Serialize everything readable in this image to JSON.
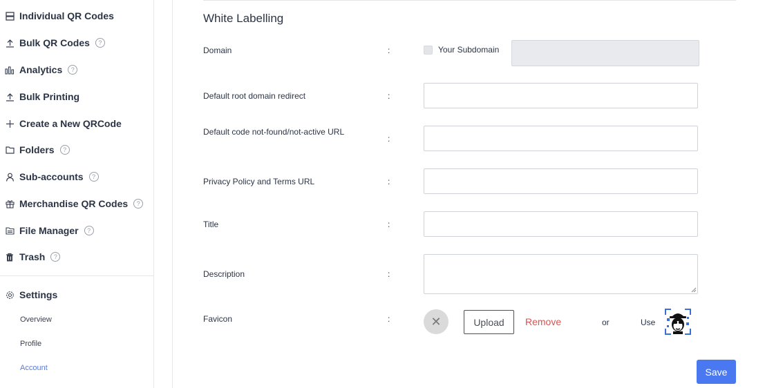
{
  "sidebar": {
    "items": [
      {
        "label": "Individual QR Codes",
        "icon": "server-icon",
        "help": false
      },
      {
        "label": "Bulk QR Codes",
        "icon": "upload-icon",
        "help": true
      },
      {
        "label": "Analytics",
        "icon": "bar-chart-icon",
        "help": true
      },
      {
        "label": "Bulk Printing",
        "icon": "upload-icon",
        "help": false
      },
      {
        "label": "Create a New QRCode",
        "icon": "plus-icon",
        "help": false
      },
      {
        "label": "Folders",
        "icon": "folder-icon",
        "help": true
      },
      {
        "label": "Sub-accounts",
        "icon": "user-icon",
        "help": true
      },
      {
        "label": "Merchandise QR Codes",
        "icon": "gift-icon",
        "help": true
      },
      {
        "label": "File Manager",
        "icon": "file-manager-icon",
        "help": true
      },
      {
        "label": "Trash",
        "icon": "trash-icon",
        "help": true
      }
    ],
    "settings": {
      "label": "Settings",
      "icon": "gear-icon",
      "sub_items": [
        {
          "label": "Overview"
        },
        {
          "label": "Profile"
        },
        {
          "label": "Account",
          "active": true
        }
      ]
    },
    "help_glyph": "?"
  },
  "form": {
    "section_title": "White Labelling",
    "colon": ":",
    "domain_label": "Domain",
    "subdomain_checkbox_label": "Your Subdomain",
    "subdomain_checked": false,
    "root_redirect_label": "Default root domain redirect",
    "not_found_label": "Default code not-found/not-active URL",
    "privacy_label": "Privacy Policy and Terms URL",
    "title_label": "Title",
    "description_label": "Description",
    "favicon_label": "Favicon",
    "root_redirect_value": "",
    "not_found_value": "",
    "privacy_value": "",
    "title_value": "",
    "description_value": ""
  },
  "favicon": {
    "clear_glyph": "✕",
    "upload_label": "Upload",
    "remove_label": "Remove",
    "or_text": "or",
    "use_text": "Use"
  },
  "save_label": "Save",
  "colors": {
    "accent": "#4a78f0",
    "remove": "#d9534f",
    "active_link": "#5b7bd5"
  }
}
